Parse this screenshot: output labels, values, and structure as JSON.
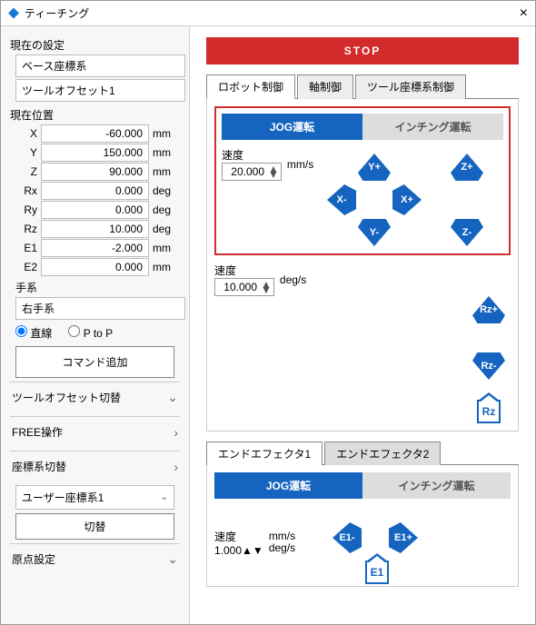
{
  "window": {
    "title": "ティーチング"
  },
  "side": {
    "current_settings_hdr": "現在の設定",
    "base_frame": "ベース座標系",
    "tool_offset": "ツールオフセット1",
    "current_pos_hdr": "現在位置",
    "axes": [
      {
        "label": "X",
        "value": "-60.000",
        "unit": "mm"
      },
      {
        "label": "Y",
        "value": "150.000",
        "unit": "mm"
      },
      {
        "label": "Z",
        "value": "90.000",
        "unit": "mm"
      },
      {
        "label": "Rx",
        "value": "0.000",
        "unit": "deg"
      },
      {
        "label": "Ry",
        "value": "0.000",
        "unit": "deg"
      },
      {
        "label": "Rz",
        "value": "10.000",
        "unit": "deg"
      },
      {
        "label": "E1",
        "value": "-2.000",
        "unit": "mm"
      },
      {
        "label": "E2",
        "value": "0.000",
        "unit": "mm"
      }
    ],
    "hand_hdr": "手系",
    "hand_val": "右手系",
    "radio_line": "直線",
    "radio_ptop": "P to P",
    "add_cmd": "コマンド追加",
    "acc_tool": "ツールオフセット切替",
    "acc_free": "FREE操作",
    "acc_coord": "座標系切替",
    "coord_sel": "ユーザー座標系1",
    "switch_btn": "切替",
    "acc_origin": "原点設定"
  },
  "main": {
    "stop": "STOP",
    "tabs": {
      "robot": "ロボット制御",
      "axis": "軸制御",
      "tool": "ツール座標系制御"
    },
    "seg": {
      "jog": "JOG運転",
      "inching": "インチング運転"
    },
    "speed_lbl": "速度",
    "speed1": "20.000",
    "speed1_unit": "mm/s",
    "speed2": "10.000",
    "speed2_unit": "deg/s",
    "btns": {
      "yp": "Y+",
      "ym": "Y-",
      "xp": "X+",
      "xm": "X-",
      "zp": "Z+",
      "zm": "Z-",
      "rzp": "Rz+",
      "rzm": "Rz-",
      "rzh": "Rz"
    },
    "ee": {
      "tab1": "エンドエフェクタ1",
      "tab2": "エンドエフェクタ2",
      "speed": "1.000",
      "unit1": "mm/s",
      "unit2": "deg/s",
      "e1m": "E1-",
      "e1p": "E1+",
      "e1h": "E1"
    }
  }
}
